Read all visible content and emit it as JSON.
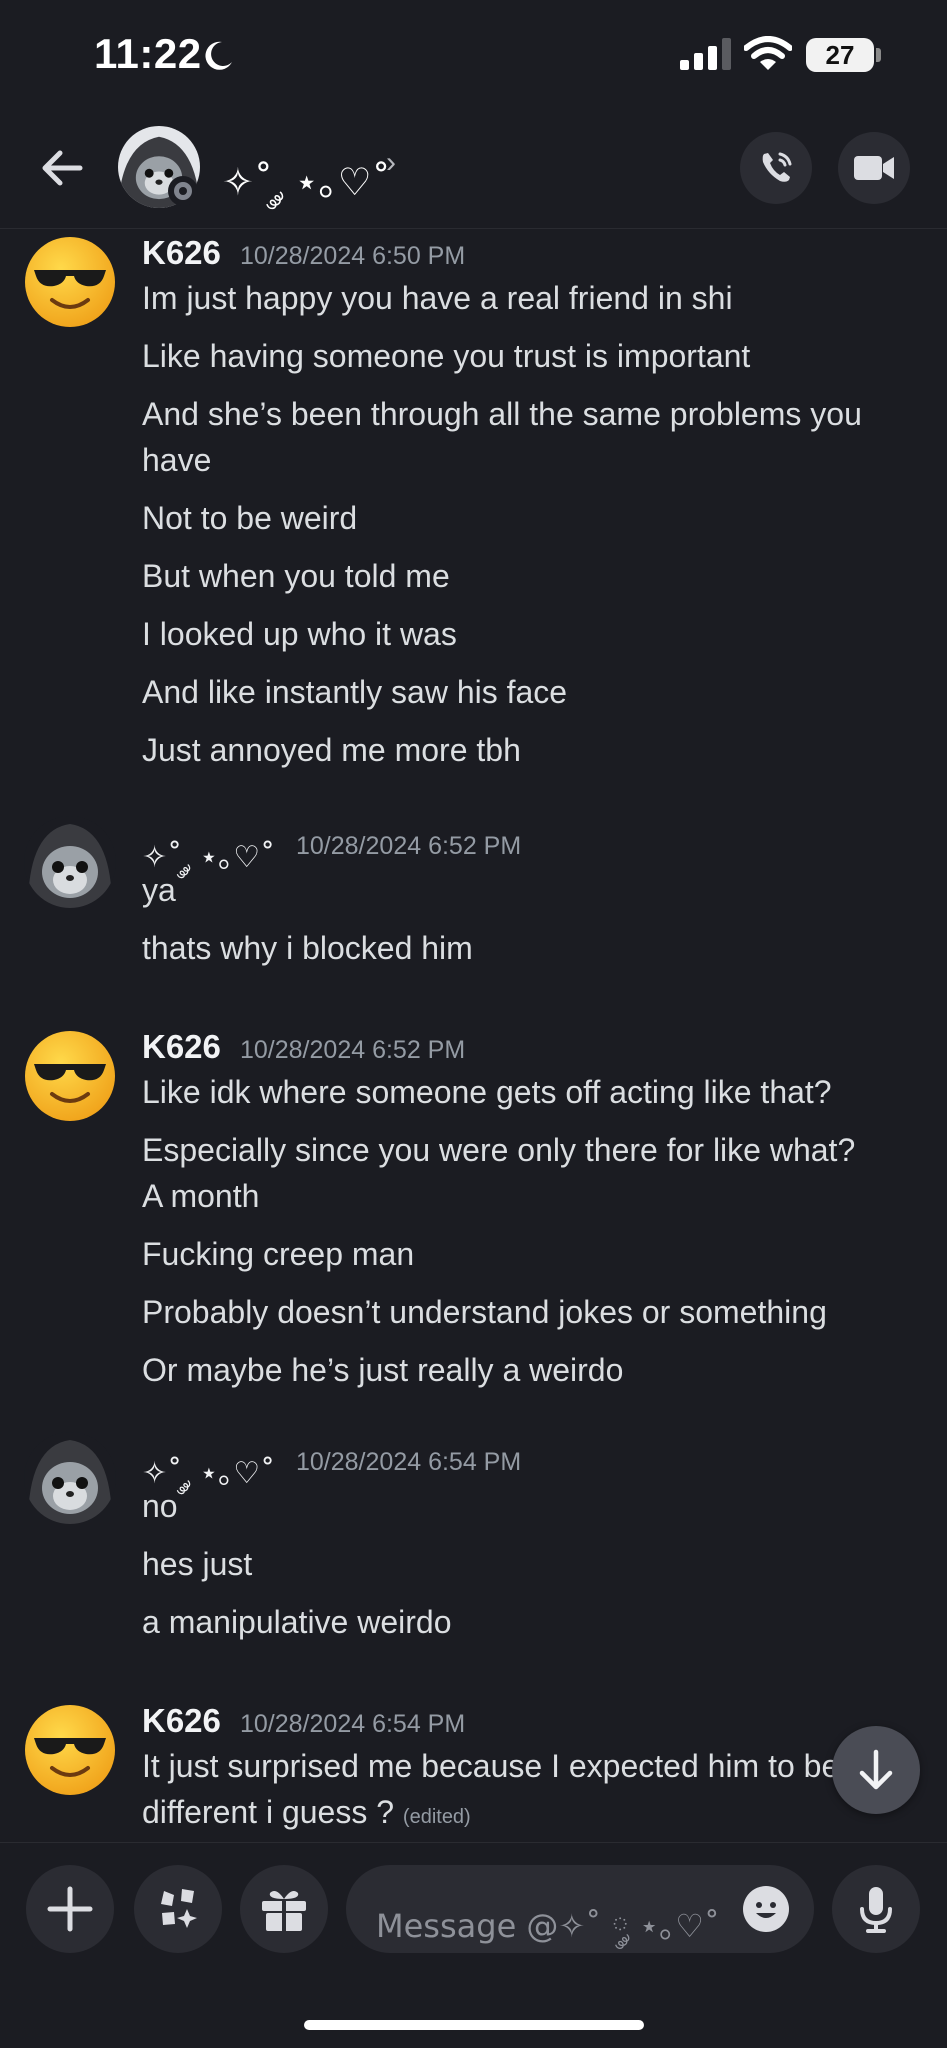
{
  "status_bar": {
    "time": "11:22",
    "battery": "27"
  },
  "header": {
    "title": "✧˚ ༘ ⋆｡♡˚",
    "chevron": "›"
  },
  "messages": [
    {
      "author": "K626",
      "timestamp": "10/28/2024 6:50 PM",
      "lines": [
        "Im just happy you have a real friend in shi",
        "Like having someone you trust is important",
        "And she’s been through all the same problems you",
        "have",
        "Not to be weird",
        "But when you told me",
        "I looked up who it was",
        "And like instantly saw his face",
        "Just annoyed me more tbh"
      ]
    },
    {
      "author": "✧˚ ༘ ⋆｡♡˚",
      "timestamp": "10/28/2024 6:52 PM",
      "lines": [
        "ya",
        "thats why i blocked him"
      ]
    },
    {
      "author": "K626",
      "timestamp": "10/28/2024 6:52 PM",
      "lines": [
        "Like idk where someone gets off acting like that?",
        "Especially since you were only there for like what?",
        "A month",
        "Fucking creep man",
        "Probably doesn’t understand jokes or something",
        "Or maybe he’s just really a weirdo"
      ]
    },
    {
      "author": "✧˚ ༘ ⋆｡♡˚",
      "timestamp": "10/28/2024 6:54 PM",
      "lines": [
        "no",
        "hes just",
        "a manipulative weirdo"
      ]
    },
    {
      "author": "K626",
      "timestamp": "10/28/2024 6:54 PM",
      "lines": [
        "It just surprised me because I expected him to be",
        "different i guess ?"
      ],
      "edited": "(edited)"
    }
  ],
  "composer": {
    "placeholder": "Message @✧˚ ༘ ⋆｡♡˚"
  },
  "colors": {
    "background": "#1b1c22",
    "button": "#2b2c33",
    "text": "#dbdee1",
    "muted": "#949ba4"
  },
  "icons": [
    "back-arrow-icon",
    "phone-call-icon",
    "video-camera-icon",
    "plus-icon",
    "apps-icon",
    "gift-icon",
    "emoji-icon",
    "microphone-icon",
    "arrow-down-icon",
    "moon-icon",
    "signal-icon",
    "wifi-icon"
  ]
}
